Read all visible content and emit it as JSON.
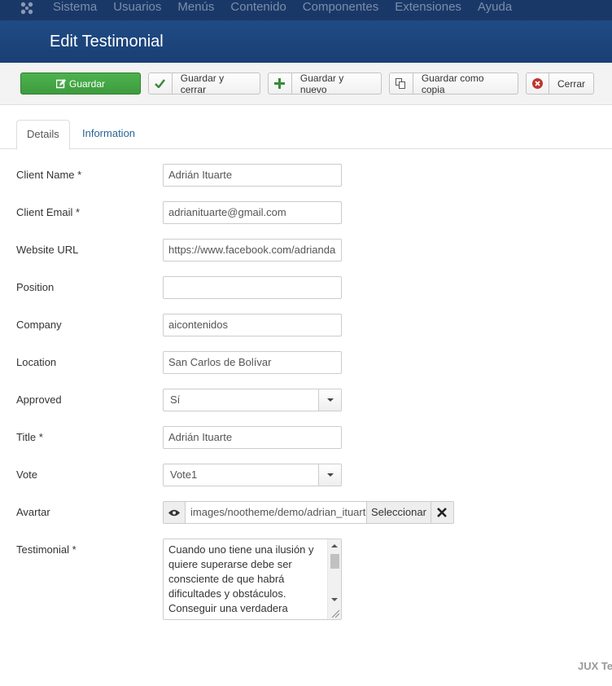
{
  "topnav": {
    "menu": [
      "Sistema",
      "Usuarios",
      "Menús",
      "Contenido",
      "Componentes",
      "Extensiones",
      "Ayuda"
    ]
  },
  "header": {
    "title": "Edit Testimonial"
  },
  "toolbar": {
    "save": "Guardar",
    "save_close": "Guardar y cerrar",
    "save_new": "Guardar y nuevo",
    "save_copy": "Guardar como copia",
    "close": "Cerrar"
  },
  "tabs": {
    "details": "Details",
    "information": "Information"
  },
  "form": {
    "client_name": {
      "label": "Client Name *",
      "value": "Adrián Ituarte"
    },
    "client_email": {
      "label": "Client Email *",
      "value": "adrianituarte@gmail.com"
    },
    "website_url": {
      "label": "Website URL",
      "value": "https://www.facebook.com/adrianda"
    },
    "position": {
      "label": "Position",
      "value": ""
    },
    "company": {
      "label": "Company",
      "value": "aicontenidos"
    },
    "location": {
      "label": "Location",
      "value": "San Carlos de Bolívar"
    },
    "approved": {
      "label": "Approved",
      "value": "Sí"
    },
    "title": {
      "label": "Title *",
      "value": "Adrián Ituarte"
    },
    "vote": {
      "label": "Vote",
      "value": "Vote1"
    },
    "avatar": {
      "label": "Avartar",
      "value": "images/nootheme/demo/adrian_ituarte",
      "select": "Seleccionar"
    },
    "testimonial": {
      "label": "Testimonial *",
      "value": "Cuando uno tiene una ilusión y quiere superarse debe ser consciente de que habrá dificultades y obstáculos. Conseguir una verdadera"
    }
  },
  "footer": {
    "brand": "JUX Te"
  },
  "colors": {
    "nav": "#1a3867",
    "header": "#1f4b85",
    "save": "#46a546",
    "link": "#2a6496"
  }
}
